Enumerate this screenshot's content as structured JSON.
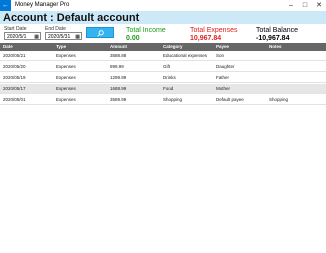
{
  "window": {
    "app_title": "Money Manager Pro",
    "back_glyph": "←",
    "minimize": "–",
    "maximize": "□",
    "close": "✕"
  },
  "header": {
    "title": "Account : Default account"
  },
  "filters": {
    "start_label": "Start Date",
    "start_value": "2020/5/1",
    "end_label": "End Date",
    "end_value": "2020/5/31",
    "calendar_glyph": "▦"
  },
  "summary": {
    "income_label": "Total Income",
    "income_value": "0.00",
    "expenses_label": "Total Expenses",
    "expenses_value": "10,967.84",
    "balance_label": "Total Balance",
    "balance_value": "-10,967.84",
    "colors": {
      "income": "#1a9c1a",
      "expenses": "#e02020",
      "balance": "#000000",
      "accent": "#33b3f0"
    }
  },
  "table": {
    "columns": [
      "Date",
      "Type",
      "Amount",
      "Category",
      "Payee",
      "Notes"
    ],
    "rows": [
      [
        "2020/05/21",
        "Expenses",
        "3588.88",
        "Educational expenses",
        "Son",
        ""
      ],
      [
        "2020/05/20",
        "Expenses",
        "899.99",
        "Gift",
        "Daughter",
        ""
      ],
      [
        "2020/05/19",
        "Expenses",
        "1299.99",
        "Drinks",
        "Father",
        ""
      ],
      [
        "2020/05/17",
        "Expenses",
        "1688.99",
        "Food",
        "Mother",
        ""
      ],
      [
        "2020/05/01",
        "Expenses",
        "3589.99",
        "Shopping",
        "Default payee",
        "Shopping"
      ]
    ]
  }
}
